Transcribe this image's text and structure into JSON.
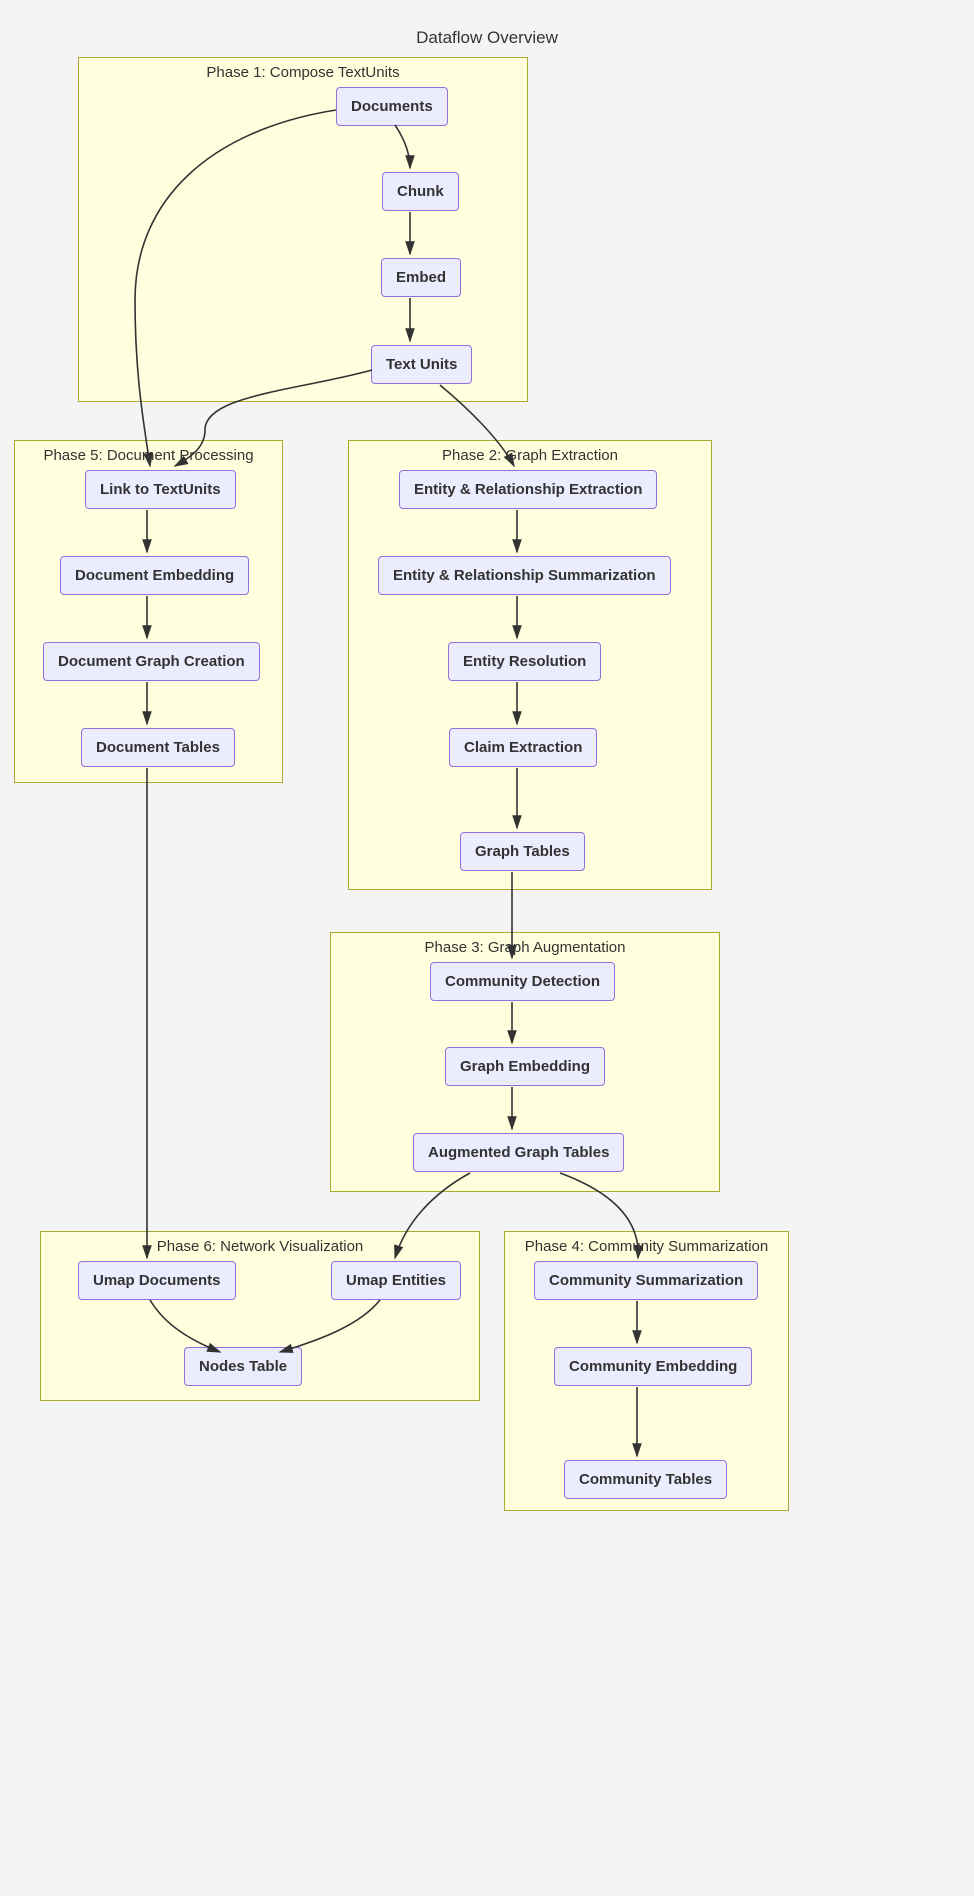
{
  "chart_data": {
    "type": "flowchart",
    "title": "Dataflow Overview",
    "phases": [
      {
        "id": "phase1",
        "title": "Phase 1: Compose TextUnits",
        "nodes": [
          "documents",
          "chunk",
          "embed",
          "text_units"
        ]
      },
      {
        "id": "phase2",
        "title": "Phase 2: Graph Extraction",
        "nodes": [
          "entity_rel_extraction",
          "entity_rel_summarization",
          "entity_resolution",
          "claim_extraction",
          "graph_tables"
        ]
      },
      {
        "id": "phase3",
        "title": "Phase 3: Graph Augmentation",
        "nodes": [
          "community_detection",
          "graph_embedding",
          "augmented_graph_tables"
        ]
      },
      {
        "id": "phase4",
        "title": "Phase 4: Community Summarization",
        "nodes": [
          "community_summarization",
          "community_embedding",
          "community_tables"
        ]
      },
      {
        "id": "phase5",
        "title": "Phase 5: Document Processing",
        "nodes": [
          "link_to_textunits",
          "document_embedding",
          "document_graph_creation",
          "document_tables"
        ]
      },
      {
        "id": "phase6",
        "title": "Phase 6: Network Visualization",
        "nodes": [
          "umap_documents",
          "umap_entities",
          "nodes_table"
        ]
      }
    ],
    "nodes": {
      "documents": "Documents",
      "chunk": "Chunk",
      "embed": "Embed",
      "text_units": "Text Units",
      "entity_rel_extraction": "Entity & Relationship Extraction",
      "entity_rel_summarization": "Entity & Relationship Summarization",
      "entity_resolution": "Entity Resolution",
      "claim_extraction": "Claim Extraction",
      "graph_tables": "Graph Tables",
      "community_detection": "Community Detection",
      "graph_embedding": "Graph Embedding",
      "augmented_graph_tables": "Augmented Graph Tables",
      "community_summarization": "Community Summarization",
      "community_embedding": "Community Embedding",
      "community_tables": "Community Tables",
      "link_to_textunits": "Link to TextUnits",
      "document_embedding": "Document Embedding",
      "document_graph_creation": "Document Graph Creation",
      "document_tables": "Document Tables",
      "umap_documents": "Umap Documents",
      "umap_entities": "Umap Entities",
      "nodes_table": "Nodes Table"
    },
    "edges": [
      [
        "documents",
        "chunk"
      ],
      [
        "chunk",
        "embed"
      ],
      [
        "embed",
        "text_units"
      ],
      [
        "documents",
        "link_to_textunits"
      ],
      [
        "text_units",
        "link_to_textunits"
      ],
      [
        "text_units",
        "entity_rel_extraction"
      ],
      [
        "entity_rel_extraction",
        "entity_rel_summarization"
      ],
      [
        "entity_rel_summarization",
        "entity_resolution"
      ],
      [
        "entity_resolution",
        "claim_extraction"
      ],
      [
        "claim_extraction",
        "graph_tables"
      ],
      [
        "graph_tables",
        "community_detection"
      ],
      [
        "community_detection",
        "graph_embedding"
      ],
      [
        "graph_embedding",
        "augmented_graph_tables"
      ],
      [
        "augmented_graph_tables",
        "community_summarization"
      ],
      [
        "augmented_graph_tables",
        "umap_entities"
      ],
      [
        "community_summarization",
        "community_embedding"
      ],
      [
        "community_embedding",
        "community_tables"
      ],
      [
        "link_to_textunits",
        "document_embedding"
      ],
      [
        "document_embedding",
        "document_graph_creation"
      ],
      [
        "document_graph_creation",
        "document_tables"
      ],
      [
        "document_tables",
        "umap_documents"
      ],
      [
        "umap_documents",
        "nodes_table"
      ],
      [
        "umap_entities",
        "nodes_table"
      ]
    ]
  },
  "title": "Dataflow Overview",
  "phase1_title": "Phase 1: Compose TextUnits",
  "phase2_title": "Phase 2: Graph Extraction",
  "phase3_title": "Phase 3: Graph Augmentation",
  "phase4_title": "Phase 4: Community Summarization",
  "phase5_title": "Phase 5: Document Processing",
  "phase6_title": "Phase 6: Network Visualization",
  "n_documents": "Documents",
  "n_chunk": "Chunk",
  "n_embed": "Embed",
  "n_text_units": "Text Units",
  "n_entity_rel_extraction": "Entity & Relationship Extraction",
  "n_entity_rel_summarization": "Entity & Relationship Summarization",
  "n_entity_resolution": "Entity Resolution",
  "n_claim_extraction": "Claim Extraction",
  "n_graph_tables": "Graph Tables",
  "n_community_detection": "Community Detection",
  "n_graph_embedding": "Graph Embedding",
  "n_augmented_graph_tables": "Augmented Graph Tables",
  "n_community_summarization": "Community Summarization",
  "n_community_embedding": "Community Embedding",
  "n_community_tables": "Community Tables",
  "n_link_to_textunits": "Link to TextUnits",
  "n_document_embedding": "Document Embedding",
  "n_document_graph_creation": "Document Graph Creation",
  "n_document_tables": "Document Tables",
  "n_umap_documents": "Umap Documents",
  "n_umap_entities": "Umap Entities",
  "n_nodes_table": "Nodes Table"
}
